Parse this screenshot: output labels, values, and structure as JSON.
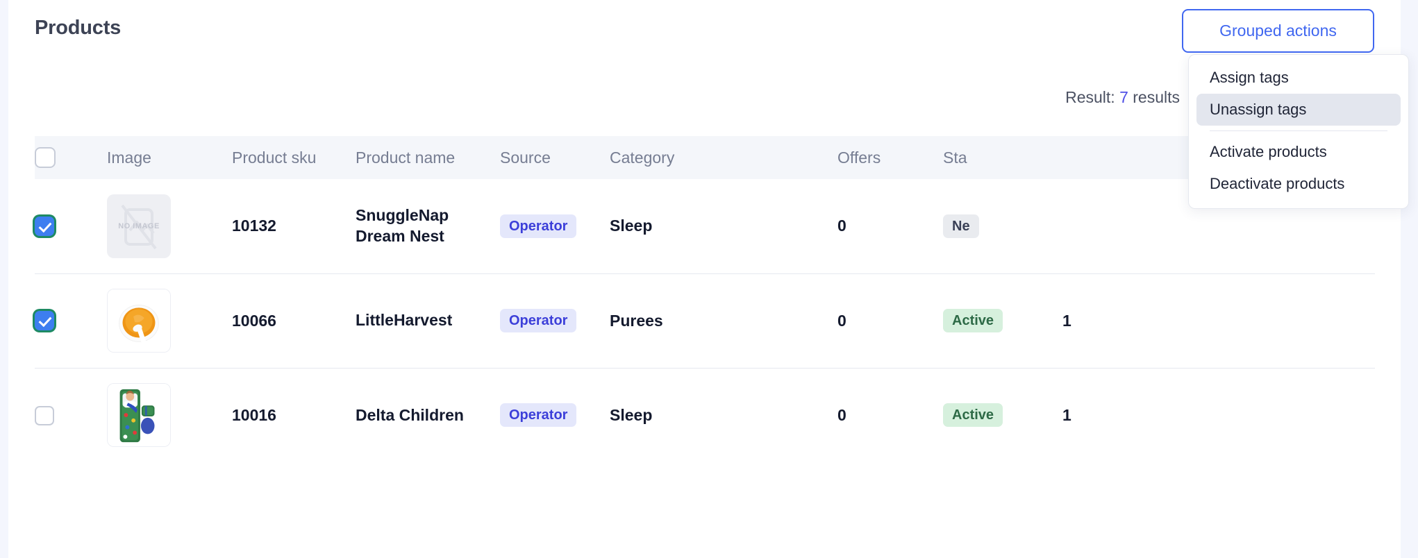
{
  "page": {
    "title": "Products"
  },
  "toolbar": {
    "grouped_actions_label": "Grouped actions",
    "accent_color": "#4067f0"
  },
  "dropdown": {
    "items": [
      {
        "label": "Assign tags",
        "highlighted": false
      },
      {
        "label": "Unassign tags",
        "highlighted": true
      },
      {
        "label": "Activate products",
        "highlighted": false
      },
      {
        "label": "Deactivate products",
        "highlighted": false
      }
    ],
    "highlight_color": "#e3e6ee"
  },
  "result": {
    "prefix": "Result:",
    "count": "7",
    "suffix": "results",
    "count_color": "#4f4fe6"
  },
  "table": {
    "headers": {
      "select_all": "",
      "image": "Image",
      "sku": "Product sku",
      "name": "Product name",
      "source": "Source",
      "category": "Category",
      "offers": "Offers",
      "status": "Sta"
    },
    "select_all_checked": false,
    "rows": [
      {
        "checked": true,
        "image_kind": "placeholder",
        "image_placeholder_label": "NO IMAGE",
        "sku": "10132",
        "name": "SnuggleNap Dream Nest",
        "source": "Operator",
        "category": "Sleep",
        "offers": "0",
        "status": "Ne",
        "status_kind": "new",
        "extra": ""
      },
      {
        "checked": true,
        "image_kind": "puree",
        "image_placeholder_label": "",
        "sku": "10066",
        "name": "LittleHarvest",
        "source": "Operator",
        "category": "Purees",
        "offers": "0",
        "status": "Active",
        "status_kind": "active",
        "extra": "1"
      },
      {
        "checked": false,
        "image_kind": "napmat",
        "image_placeholder_label": "",
        "sku": "10016",
        "name": "Delta Children",
        "source": "Operator",
        "category": "Sleep",
        "offers": "0",
        "status": "Active",
        "status_kind": "active",
        "extra": "1"
      }
    ]
  }
}
